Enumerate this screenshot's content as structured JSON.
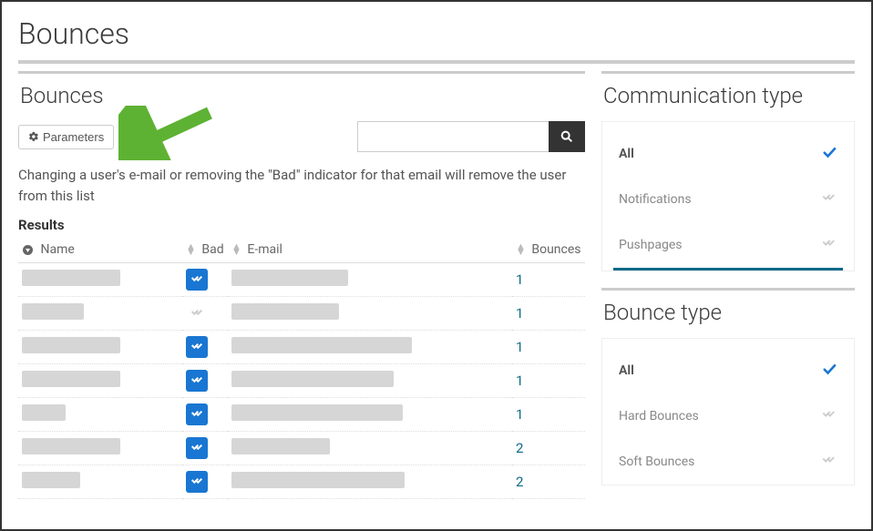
{
  "page": {
    "title": "Bounces"
  },
  "main": {
    "panel_title": "Bounces",
    "parameters_btn": "Parameters",
    "help_text": "Changing a user's e-mail or removing the \"Bad\" indicator for that email will remove the user from this list",
    "results_label": "Results",
    "columns": {
      "name": "Name",
      "bad": "Bad",
      "email": "E-mail",
      "bounces": "Bounces"
    },
    "rows": [
      {
        "name_width": 108,
        "bad": true,
        "email_width": 128,
        "bounces": "1"
      },
      {
        "name_width": 68,
        "bad": false,
        "email_width": 118,
        "bounces": "1"
      },
      {
        "name_width": 108,
        "bad": true,
        "email_width": 198,
        "bounces": "1"
      },
      {
        "name_width": 108,
        "bad": true,
        "email_width": 178,
        "bounces": "1"
      },
      {
        "name_width": 48,
        "bad": true,
        "email_width": 188,
        "bounces": "1"
      },
      {
        "name_width": 108,
        "bad": true,
        "email_width": 108,
        "bounces": "2"
      },
      {
        "name_width": 64,
        "bad": true,
        "email_width": 190,
        "bounces": "2"
      }
    ]
  },
  "sidebar": {
    "comm_type": {
      "title": "Communication type",
      "items": [
        {
          "label": "All",
          "active": true
        },
        {
          "label": "Notifications",
          "active": false
        },
        {
          "label": "Pushpages",
          "active": false
        }
      ]
    },
    "bounce_type": {
      "title": "Bounce type",
      "items": [
        {
          "label": "All",
          "active": true
        },
        {
          "label": "Hard Bounces",
          "active": false
        },
        {
          "label": "Soft Bounces",
          "active": false
        }
      ]
    }
  },
  "colors": {
    "primary": "#1976d2",
    "teal": "#0d6986",
    "arrow": "#5eb233"
  }
}
